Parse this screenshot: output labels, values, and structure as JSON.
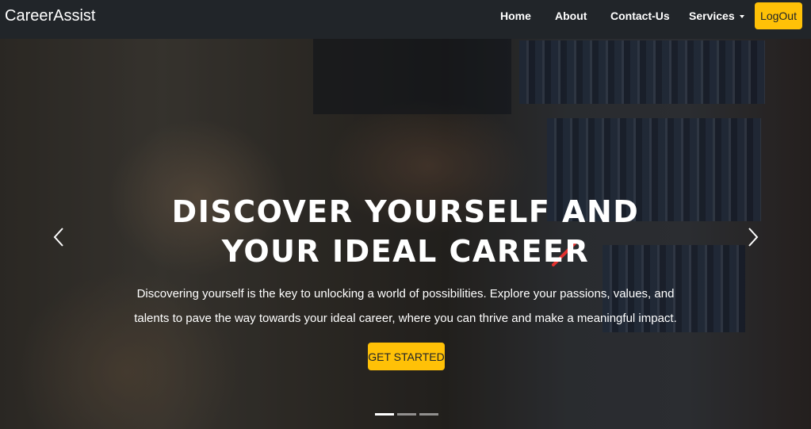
{
  "nav": {
    "brand": "CareerAssist",
    "links": {
      "home": "Home",
      "about": "About",
      "contact": "Contact-Us",
      "services": "Services"
    },
    "logout": "LogOut"
  },
  "hero": {
    "title": "DISCOVER YOURSELF AND YOUR IDEAL CAREER",
    "text": "Discovering yourself is the key to unlocking a world of possibilities. Explore your passions, values, and talents to pave the way towards your ideal career, where you can thrive and make a meaningful impact.",
    "cta": "GET STARTED",
    "slides": {
      "count": 3,
      "active": 1
    }
  },
  "icons": {
    "prev": "chevron-left-icon",
    "next": "chevron-right-icon",
    "services_caret": "caret-down-icon"
  },
  "colors": {
    "navbar": "#212529",
    "accent": "#ffc107",
    "text": "#ffffff"
  }
}
